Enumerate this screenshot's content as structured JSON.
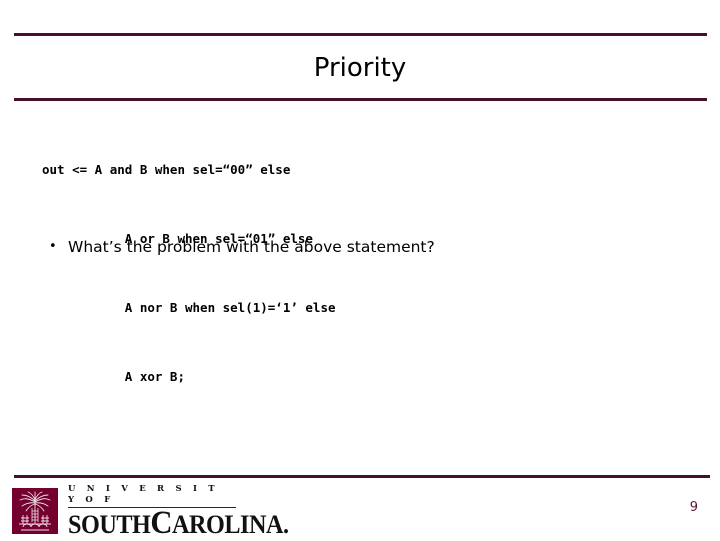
{
  "slide": {
    "title": "Priority",
    "page_number": "9"
  },
  "code": {
    "lines": [
      "out <= A and B when sel=“00” else",
      "           A or B when sel=“01” else",
      "           A nor B when sel(1)=‘1’ else",
      "           A xor B;"
    ]
  },
  "bullets": [
    {
      "marker": "•",
      "text": "What’s the problem with the above statement?"
    }
  ],
  "logo": {
    "emblem_name": "palmetto-tree-emblem",
    "line1": "U N I V E R S I T Y     O F",
    "line2_pre": "S",
    "line2": "OUTH",
    "line2_c": "C",
    "line2_post": "AROLINA."
  },
  "colors": {
    "rule": "#45102f",
    "logo_maroon": "#73002e",
    "page_number": "#5b1135"
  }
}
